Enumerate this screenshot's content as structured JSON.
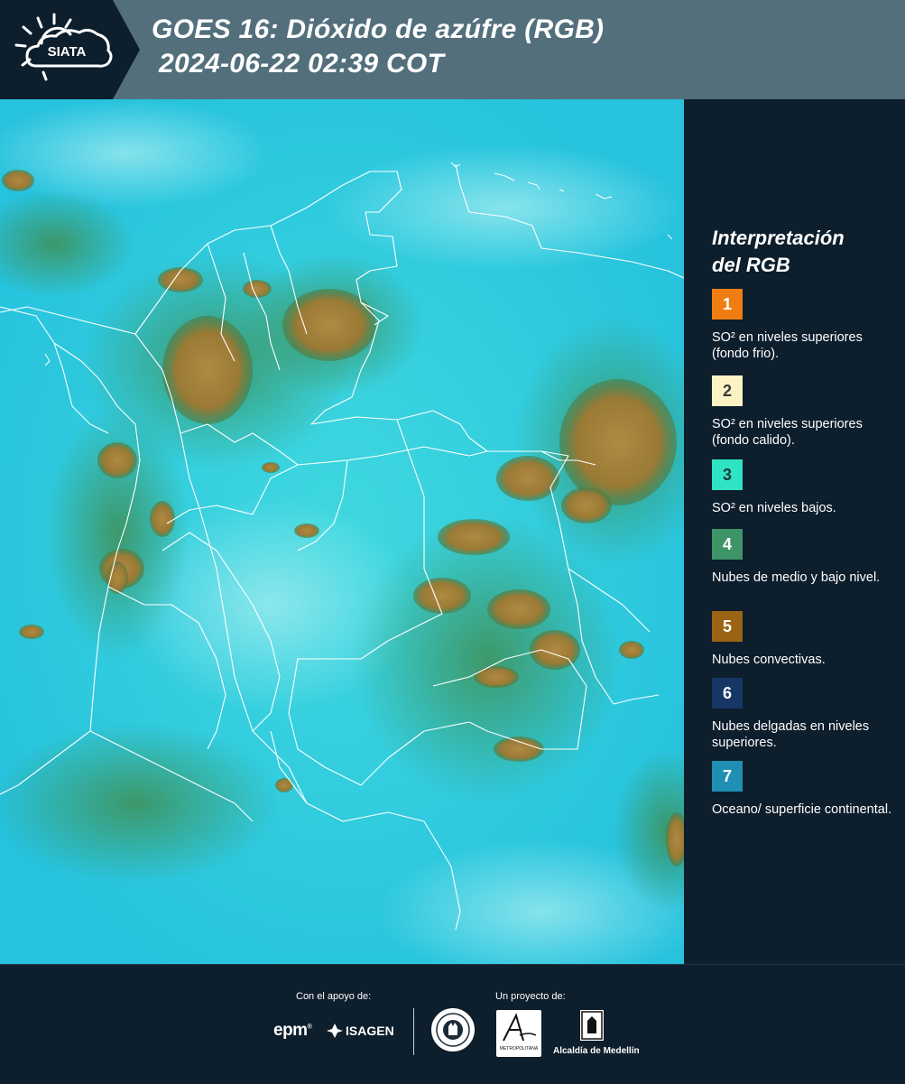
{
  "header": {
    "logo_text": "SIATA",
    "title_line1": "GOES 16: Dióxido de azúfre (RGB)",
    "title_line2": "2024-06-22 02:39 COT",
    "background_color": "#536f7c",
    "logo_background_color": "#0d1e2c"
  },
  "map": {
    "description_icon": "satellite-rgb-composite",
    "boundary_line_color": "#ffffff"
  },
  "legend": {
    "title_line1": "Interpretación",
    "title_line2": "del RGB",
    "items": [
      {
        "number": "1",
        "label": "SO² en niveles superiores (fondo frio).",
        "color": "#f07d12",
        "text_color": "#ffffff"
      },
      {
        "number": "2",
        "label": "SO² en niveles superiores (fondo calido).",
        "color": "#fbf3c4",
        "text_color": "#3a3a3a"
      },
      {
        "number": "3",
        "label": "SO² en niveles bajos.",
        "color": "#2fe3c3",
        "text_color": "#1a3a3a"
      },
      {
        "number": "4",
        "label": "Nubes de medio y bajo nivel.",
        "color": "#3f9467",
        "text_color": "#ffffff"
      },
      {
        "number": "5",
        "label": "Nubes convectivas.",
        "color": "#9a6414",
        "text_color": "#ffffff"
      },
      {
        "number": "6",
        "label": "Nubes delgadas en niveles superiores.",
        "color": "#163666",
        "text_color": "#ffffff"
      },
      {
        "number": "7",
        "label": "Oceano/ superficie continental.",
        "color": "#1f8fb4",
        "text_color": "#ffffff"
      }
    ]
  },
  "footer": {
    "support_label": "Con el apoyo de:",
    "project_label": "Un proyecto de:",
    "epm_text": "epm",
    "isagen_text": "ISAGEN",
    "area_text": "METROPOLITANA",
    "alcaldia_text": "Alcaldía de Medellín"
  }
}
